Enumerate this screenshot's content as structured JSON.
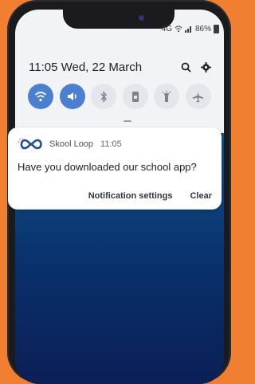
{
  "status_bar": {
    "battery": "86%",
    "network": "4G"
  },
  "header": {
    "time": "11:05",
    "date": "Wed, 22 March"
  },
  "quick_settings": [
    {
      "name": "wifi",
      "on": true
    },
    {
      "name": "sound",
      "on": true
    },
    {
      "name": "bluetooth",
      "on": false
    },
    {
      "name": "portrait",
      "on": false
    },
    {
      "name": "flashlight",
      "on": false
    },
    {
      "name": "airplane",
      "on": false
    }
  ],
  "notification": {
    "app": "Skool Loop",
    "time": "11:05",
    "message": "Have you downloaded our school app?",
    "action_settings": "Notification settings",
    "action_clear": "Clear"
  },
  "colors": {
    "background": "#f07f32",
    "accent": "#4b7fcf"
  }
}
